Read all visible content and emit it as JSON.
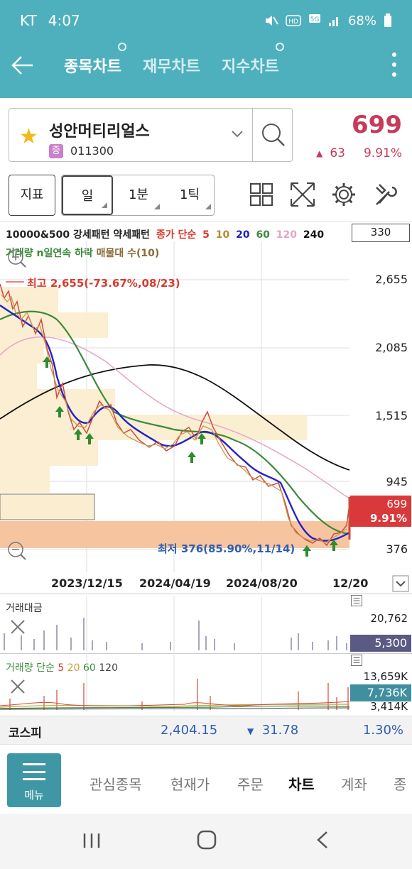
{
  "status": {
    "carrier": "KT",
    "time": "4:07",
    "battery": "68%",
    "icons": [
      "mute-icon",
      "hd-icon",
      "5g-icon",
      "signal-icon",
      "battery-icon"
    ]
  },
  "header": {
    "tabs": [
      {
        "label": "종목차트",
        "active": true
      },
      {
        "label": "재무차트",
        "active": false
      },
      {
        "label": "지수차트",
        "active": false
      }
    ]
  },
  "stock": {
    "name": "성안머티리얼스",
    "badge": "증",
    "code": "011300",
    "price": "699",
    "change": "63",
    "change_pct": "9.91%",
    "colors": {
      "up": "#c73a5b",
      "accent": "#4fb0bd"
    }
  },
  "toolbar": {
    "indicator_label": "지표",
    "periods": [
      "일",
      "1분",
      "1틱"
    ]
  },
  "chart": {
    "legend_main": "10000&500 강세패턴 약세패턴",
    "legend_close": "종가 단순",
    "legend_ma": [
      "5",
      "10",
      "20",
      "60",
      "120",
      "240"
    ],
    "legend_volume": "거래량 n일연속 하락",
    "legend_vp": "매물대 수(10)",
    "count_box": "330",
    "high_annotation": "최고 2,655(-73.67%,08/23)",
    "low_annotation": "최저 376(85.90%,11/14)",
    "price_tag": "699",
    "price_tag_pct": "9.91%",
    "y_ticks": [
      "2,655",
      "2,085",
      "1,515",
      "945",
      "376"
    ],
    "x_ticks": [
      "2023/12/15",
      "2024/04/19",
      "2024/08/20",
      "12/20"
    ]
  },
  "amount_panel": {
    "title": "거래대금",
    "max_label": "20,762",
    "current": "5,300"
  },
  "volume_panel": {
    "title": "거래량 단순",
    "ma": [
      "5",
      "20",
      "60",
      "120"
    ],
    "max_label": "13,659K",
    "current": "7,736K",
    "min_label": "3,414K"
  },
  "index": {
    "name": "코스피",
    "value": "2,404.15",
    "change": "31.78",
    "change_pct": "1.30%"
  },
  "bottom_nav": {
    "menu_label": "메뉴",
    "items": [
      {
        "label": "관심종목",
        "active": false
      },
      {
        "label": "현재가",
        "active": false
      },
      {
        "label": "주문",
        "active": false
      },
      {
        "label": "차트",
        "active": true
      },
      {
        "label": "계좌",
        "active": false
      },
      {
        "label": "종",
        "active": false
      }
    ]
  }
}
